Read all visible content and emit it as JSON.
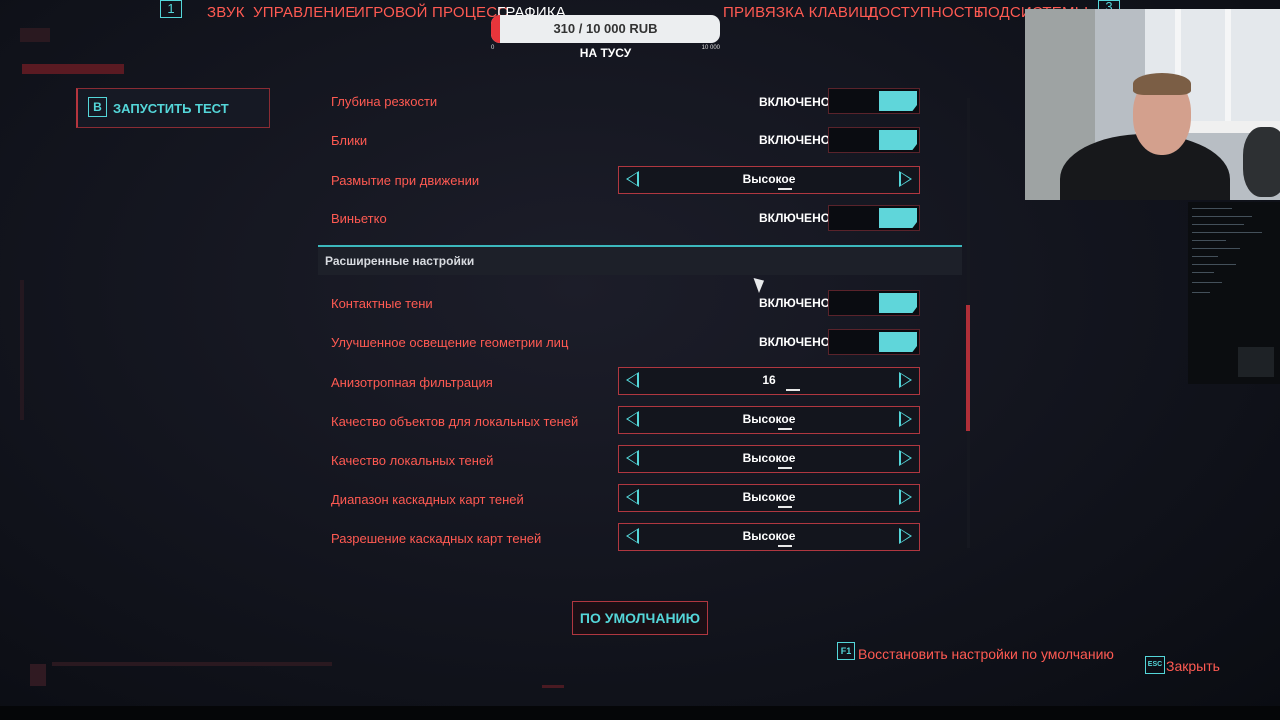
{
  "tabs": {
    "left_index": "1",
    "right_index": "3",
    "items": [
      "ЗВУК",
      "УПРАВЛЕНИЕ",
      "ИГРОВОЙ ПРОЦЕСС",
      "ГРАФИКА",
      "ПРИВЯЗКА КЛАВИШ",
      "ДОСТУПНОСТЬ",
      "ПОДСИСТЕМЫ"
    ]
  },
  "donation": {
    "progress_text": "310 / 10 000 RUB",
    "progress_fraction": 0.031,
    "min": "0",
    "max": "10 000",
    "label": "НА ТУСУ"
  },
  "launch_test": {
    "key": "B",
    "label": "ЗАПУСТИТЬ ТЕСТ"
  },
  "settings": {
    "depth_of_field": {
      "label": "Глубина резкости",
      "value": "ВКЛЮЧЕНО",
      "enabled": true
    },
    "lens_flare": {
      "label": "Блики",
      "value": "ВКЛЮЧЕНО",
      "enabled": true
    },
    "motion_blur": {
      "label": "Размытие при движении",
      "value": "Высокое"
    },
    "vignette": {
      "label": "Виньетко",
      "value": "ВКЛЮЧЕНО",
      "enabled": true
    },
    "advanced_title": "Расширенные настройки",
    "contact_shadows": {
      "label": "Контактные тени",
      "value": "ВКЛЮЧЕНО",
      "enabled": true
    },
    "face_lighting": {
      "label": "Улучшенное освещение геометрии лиц",
      "value": "ВКЛЮЧЕНО",
      "enabled": true
    },
    "anisotropy": {
      "label": "Анизотропная фильтрация",
      "value": "16"
    },
    "local_shadow_mesh": {
      "label": "Качество объектов для локальных теней",
      "value": "Высокое"
    },
    "local_shadow_quality": {
      "label": "Качество локальных теней",
      "value": "Высокое"
    },
    "cascade_range": {
      "label": "Диапазон каскадных карт теней",
      "value": "Высокое"
    },
    "cascade_resolution": {
      "label": "Разрешение каскадных карт теней",
      "value": "Высокое"
    }
  },
  "default_button": "ПО УМОЛЧАНИЮ",
  "hints": {
    "restore_key": "F1",
    "restore_label": "Восстановить настройки по умолчанию",
    "close_key": "ESC",
    "close_label": "Закрыть"
  },
  "colors": {
    "accent_red": "#ff5a52",
    "accent_cyan": "#54d6d9",
    "background": "#12141d"
  }
}
